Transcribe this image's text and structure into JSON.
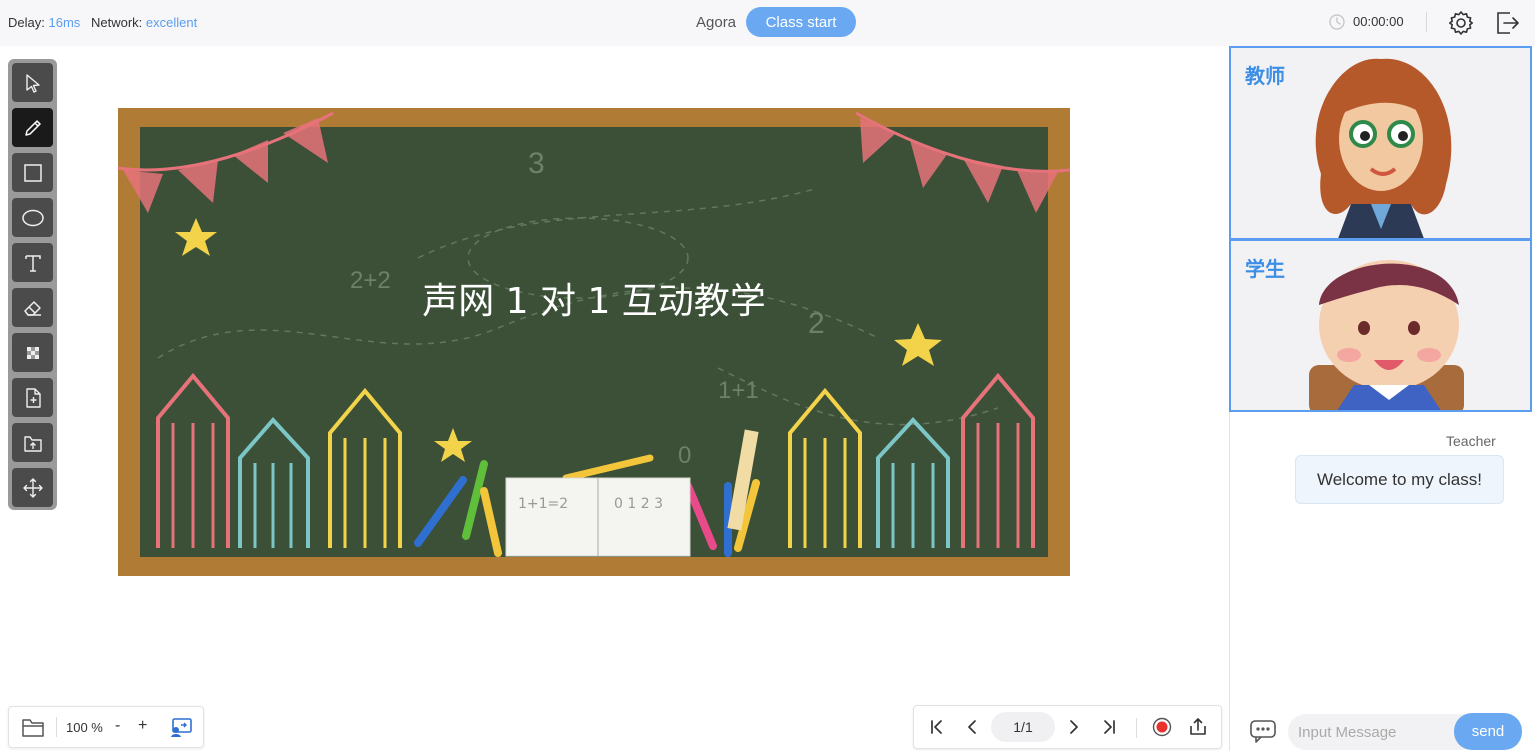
{
  "topbar": {
    "delay_label": "Delay:",
    "delay_value": "16ms",
    "network_label": "Network:",
    "network_value": "excellent",
    "room_name": "Agora",
    "class_button": "Class start",
    "timer": "00:00:00",
    "icons": [
      "clock-icon",
      "settings-icon",
      "exit-icon"
    ]
  },
  "toolbar": {
    "tools": [
      "selector",
      "pencil",
      "rectangle",
      "ellipse",
      "text",
      "eraser",
      "color-picker",
      "add-page",
      "upload",
      "hand"
    ],
    "active_tool": "pencil"
  },
  "board": {
    "title": "声网 1 对 1 互动教学",
    "book_text_left": "1+1=2",
    "book_text_right": "0 1 2 3",
    "chalk_numbers": [
      "3",
      "2+2",
      "2",
      "1+1",
      "0"
    ]
  },
  "videos": {
    "teacher_label": "教师",
    "student_label": "学生"
  },
  "chat": {
    "sender": "Teacher",
    "message": "Welcome to my class!",
    "input_placeholder": "Input Message",
    "send_label": "send"
  },
  "bottom_tools": {
    "zoom": "100 %",
    "minus": "-",
    "plus": "+"
  },
  "pager": {
    "page": "1/1"
  },
  "colors": {
    "accent": "#6aa9f2",
    "chalkboard": "#3b5037",
    "frame": "#b07c35",
    "record": "#e8322f"
  }
}
